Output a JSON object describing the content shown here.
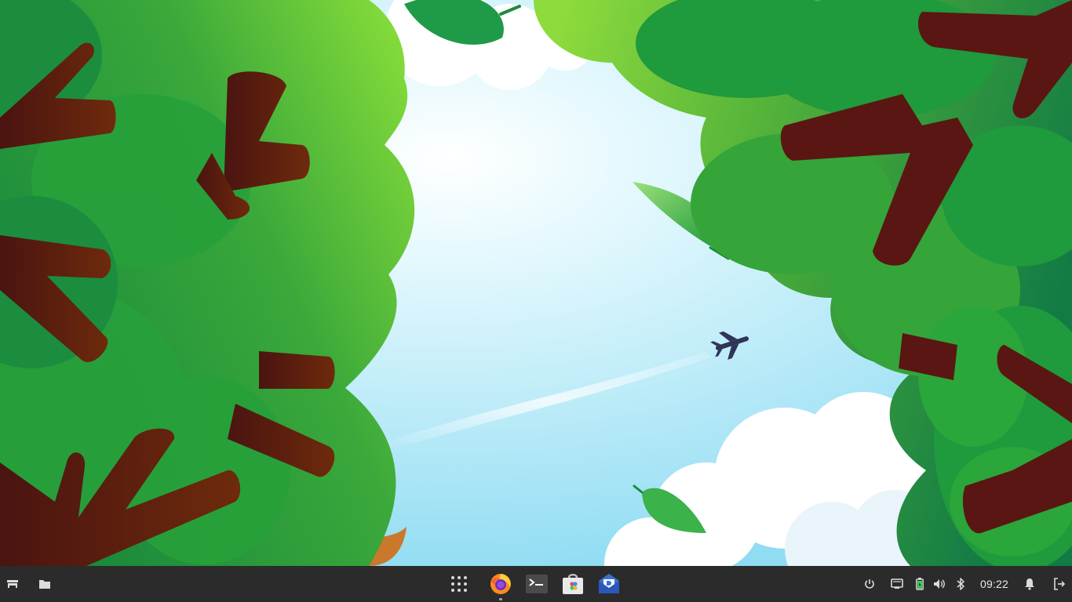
{
  "desktop": {
    "wallpaper": "forest-canopy-sky-airplane",
    "colors": {
      "sky": "#bfeefc",
      "foliage_light": "#8ed93a",
      "foliage_dark": "#1f8f3a",
      "branch": "#5a1a10"
    }
  },
  "taskbar": {
    "background": "#2b2b2b",
    "left": [
      {
        "name": "show-desktop",
        "icon": "drawer-icon"
      },
      {
        "name": "file-manager",
        "icon": "folder-icon"
      }
    ],
    "center": [
      {
        "name": "app-grid",
        "icon": "grid-icon"
      },
      {
        "name": "firefox",
        "icon": "firefox-icon",
        "running": true
      },
      {
        "name": "terminal",
        "icon": "terminal-icon"
      },
      {
        "name": "software-store",
        "icon": "store-icon"
      },
      {
        "name": "mail",
        "icon": "mail-icon"
      }
    ],
    "tray": [
      {
        "name": "power",
        "icon": "power-icon"
      },
      {
        "name": "network",
        "icon": "network-icon"
      },
      {
        "name": "battery",
        "icon": "battery-icon"
      },
      {
        "name": "volume",
        "icon": "volume-icon"
      },
      {
        "name": "bluetooth",
        "icon": "bluetooth-icon"
      }
    ],
    "clock": "09:22",
    "right": [
      {
        "name": "notifications",
        "icon": "bell-icon"
      },
      {
        "name": "logout",
        "icon": "logout-icon"
      }
    ]
  }
}
